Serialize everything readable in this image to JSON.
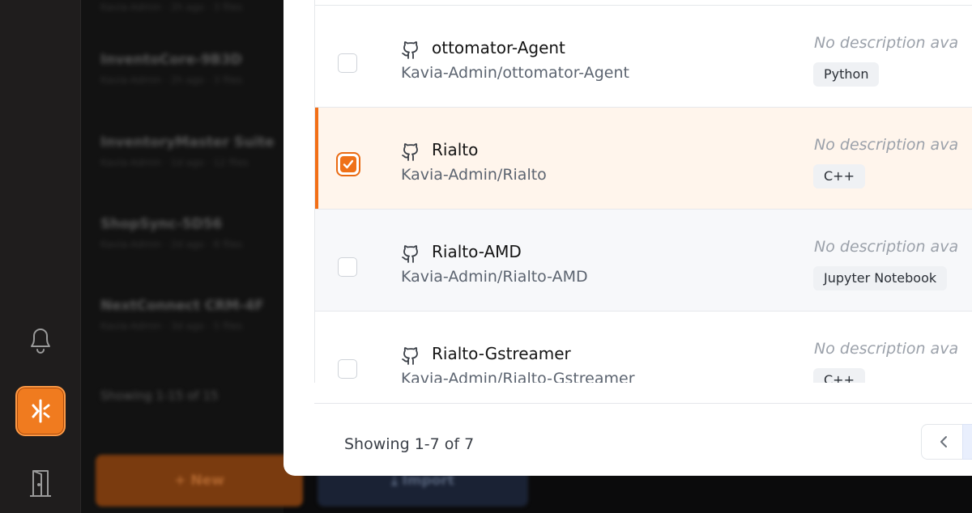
{
  "background": {
    "items": [
      {
        "title": "InventoCore-9B3D",
        "subtitle": "Kavia-Admin · 2h ago · 3 files"
      },
      {
        "title": "InventoryMaster Suite",
        "subtitle": "Kavia-Admin · 1d ago · 12 files"
      },
      {
        "title": "ShopSync-5D56",
        "subtitle": "Kavia-Admin · 2d ago · 8 files"
      },
      {
        "title": "NextConnect CRM-4F",
        "subtitle": "Kavia-Admin · 3d ago · 5 files"
      }
    ],
    "showing": "Showing 1-15 of 15",
    "new_label": "+ New",
    "import_label": "⤓ Import"
  },
  "repos": [
    {
      "name": "ottomator-Agent",
      "path": "Kavia-Admin/ottomator-Agent",
      "description": "No description ava",
      "language": "Python",
      "checked": false
    },
    {
      "name": "Rialto",
      "path": "Kavia-Admin/Rialto",
      "description": "No description ava",
      "language": "C++",
      "checked": true
    },
    {
      "name": "Rialto-AMD",
      "path": "Kavia-Admin/Rialto-AMD",
      "description": "No description ava",
      "language": "Jupyter Notebook",
      "checked": false
    },
    {
      "name": "Rialto-Gstreamer",
      "path": "Kavia-Admin/Rialto-Gstreamer",
      "description": "No description ava",
      "language": "C++",
      "checked": false
    }
  ],
  "footer": {
    "showing": "Showing 1-7 of 7"
  },
  "colors": {
    "accent": "#f26f17",
    "selected_row": "#fff5ec"
  },
  "icons": {
    "bell": "bell-icon",
    "brand": "kavia-logo-icon",
    "door": "logout-door-icon",
    "repo": "github-icon",
    "prev": "chevron-left-icon"
  }
}
